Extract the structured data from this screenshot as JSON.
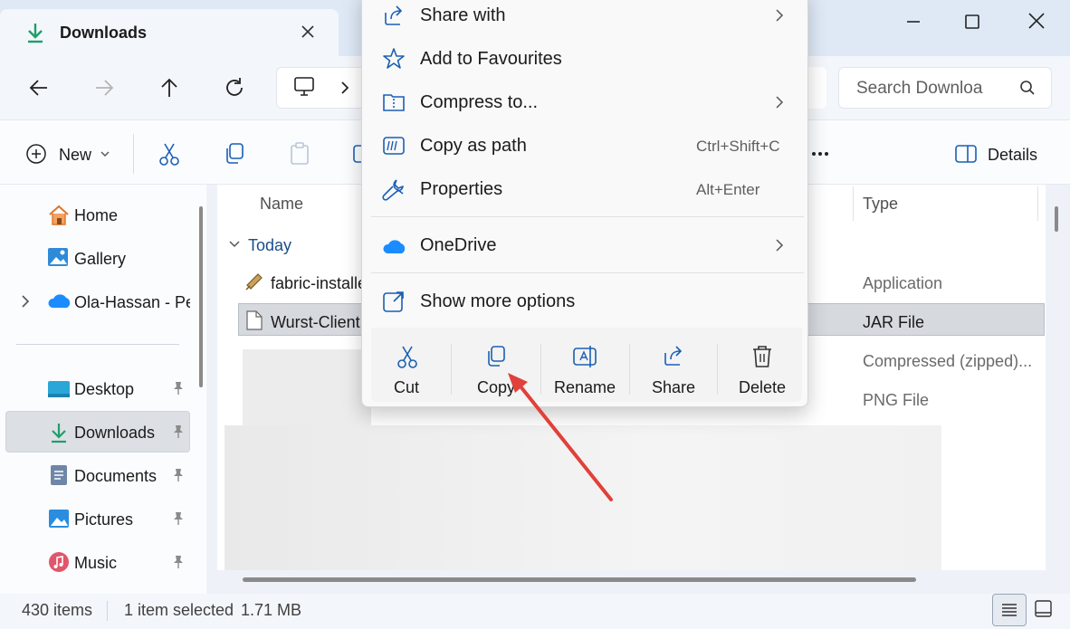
{
  "window": {
    "tab_title": "Downloads"
  },
  "nav": {
    "search_placeholder": "Search Downloa"
  },
  "command_bar": {
    "new_label": "New",
    "details_label": "Details"
  },
  "sidebar": {
    "items": [
      {
        "label": "Home",
        "icon": "home-icon"
      },
      {
        "label": "Gallery",
        "icon": "gallery-icon"
      },
      {
        "label": "Ola-Hassan - Per",
        "icon": "onedrive-cloud-icon"
      },
      {
        "label": "Desktop",
        "icon": "desktop-folder-icon"
      },
      {
        "label": "Downloads",
        "icon": "downloads-folder-icon"
      },
      {
        "label": "Documents",
        "icon": "documents-folder-icon"
      },
      {
        "label": "Pictures",
        "icon": "pictures-folder-icon"
      },
      {
        "label": "Music",
        "icon": "music-folder-icon"
      }
    ]
  },
  "file_list": {
    "columns": [
      "Name",
      "Type"
    ],
    "group": "Today",
    "rows": [
      {
        "name": "fabric-installe",
        "type": "Application"
      },
      {
        "name": "Wurst-Client",
        "type": "JAR File"
      },
      {
        "name": "",
        "type": "Compressed (zipped)..."
      },
      {
        "name": "",
        "type": "PNG File"
      }
    ]
  },
  "context_menu": {
    "items": [
      {
        "label": "Share with",
        "shortcut": "",
        "submenu": true
      },
      {
        "label": "Add to Favourites",
        "shortcut": "",
        "submenu": false
      },
      {
        "label": "Compress to...",
        "shortcut": "",
        "submenu": true
      },
      {
        "label": "Copy as path",
        "shortcut": "Ctrl+Shift+C",
        "submenu": false
      },
      {
        "label": "Properties",
        "shortcut": "Alt+Enter",
        "submenu": false
      },
      {
        "label": "OneDrive",
        "shortcut": "",
        "submenu": true
      },
      {
        "label": "Show more options",
        "shortcut": "",
        "submenu": false
      }
    ],
    "quick_actions": [
      "Cut",
      "Copy",
      "Rename",
      "Share",
      "Delete"
    ]
  },
  "status_bar": {
    "item_count": "430 items",
    "selected": "1 item selected",
    "size": "1.71 MB"
  },
  "colors": {
    "accent": "#0f6cbd",
    "download_green": "#1e9e6a",
    "arrow_red": "#e0413a"
  }
}
